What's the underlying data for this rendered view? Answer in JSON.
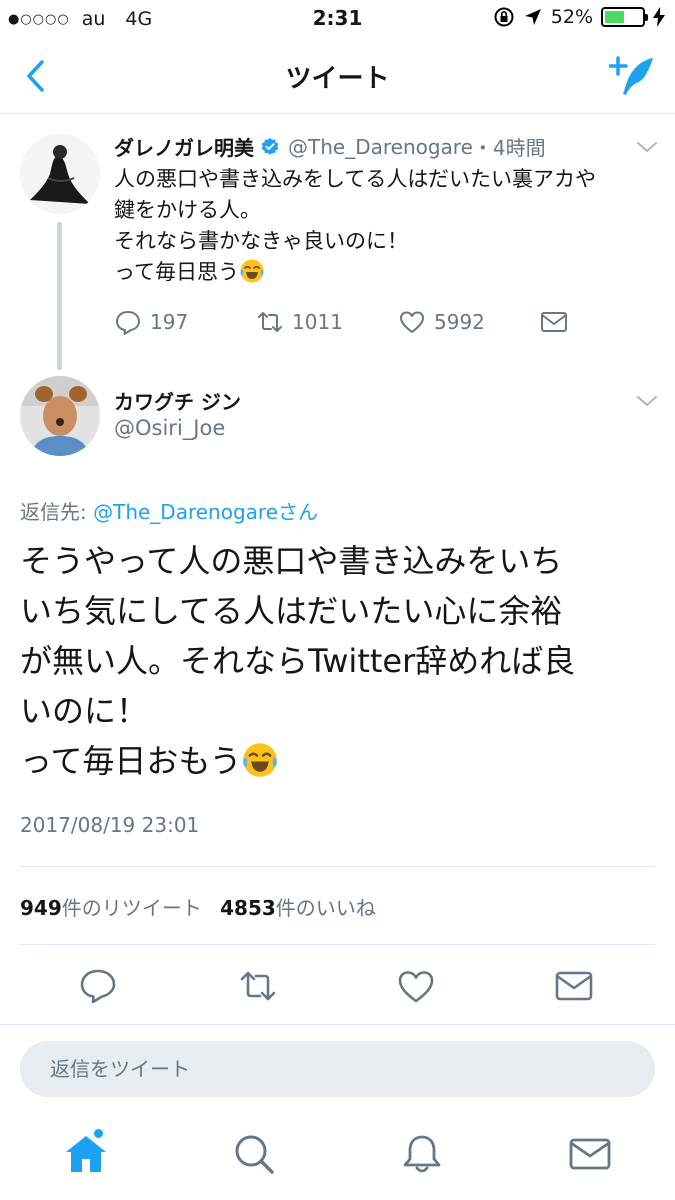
{
  "status_bar": {
    "signal_dots": "●○○○○",
    "carrier": "au",
    "network": "4G",
    "time": "2:31",
    "battery_percent": "52%",
    "battery_level": 0.52,
    "battery_color": "#4cd964"
  },
  "nav": {
    "title": "ツイート",
    "back_icon": "chevron-left-icon",
    "compose_icon": "compose-tweet-icon",
    "accent": "#1da1f2"
  },
  "parent_tweet": {
    "name": "ダレノガレ明美",
    "verified": true,
    "handle": "@The_Darenogare",
    "time": "・4時間",
    "body_lines": [
      "人の悪口や書き込みをしてる人はだいたい裏アカや",
      "鍵をかける人。",
      "それなら書かなきゃ良いのに！",
      "って毎日思う"
    ],
    "body_emoji": "face-with-tears-of-joy",
    "replies": "197",
    "retweets": "1011",
    "likes": "5992"
  },
  "reply_tweet": {
    "name": "カワグチ ジン",
    "handle": "@Osiri_Joe",
    "reply_to_prefix": "返信先: ",
    "reply_to_mention": "@The_Darenogare",
    "reply_to_suffix": "さん",
    "body_lines": [
      "そうやって人の悪口や書き込みをいち",
      "いち気にしてる人はだいたい心に余裕",
      "が無い人。それならTwitter辞めれば良",
      "いのに！",
      "って毎日おもう"
    ],
    "body_emoji": "face-with-tears-of-joy",
    "date": "2017/08/19 23:01",
    "retweet_count": "949",
    "retweet_label": "件のリツイート",
    "like_count": "4853",
    "like_label": "件のいいね"
  },
  "reply_box": {
    "placeholder": "返信をツイート"
  },
  "tab_bar": {
    "items": [
      "home-icon",
      "search-icon",
      "notifications-icon",
      "messages-icon"
    ],
    "active": "home-icon",
    "unread_dot": true
  }
}
